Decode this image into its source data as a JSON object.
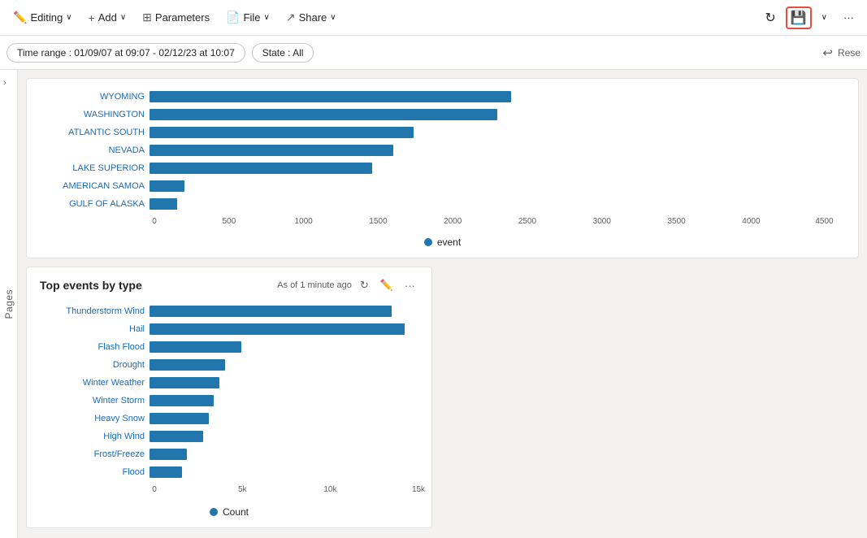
{
  "toolbar": {
    "editing_label": "Editing",
    "add_label": "Add",
    "parameters_label": "Parameters",
    "file_label": "File",
    "share_label": "Share",
    "refresh_icon": "↻",
    "save_icon": "💾",
    "more_icon": "···",
    "chevron_icon": "∨"
  },
  "filter_bar": {
    "time_range_label": "Time range : 01/09/07 at 09:07 - 02/12/23 at 10:07",
    "state_label": "State : All",
    "undo_icon": "↩",
    "reset_label": "Rese"
  },
  "pages_sidebar": {
    "label": "Pages",
    "chevron": "›"
  },
  "top_chart": {
    "rows": [
      {
        "label": "WYOMING",
        "pct": 52
      },
      {
        "label": "WASHINGTON",
        "pct": 50
      },
      {
        "label": "ATLANTIC SOUTH",
        "pct": 38
      },
      {
        "label": "NEVADA",
        "pct": 35
      },
      {
        "label": "LAKE SUPERIOR",
        "pct": 32
      },
      {
        "label": "AMERICAN SAMOA",
        "pct": 5
      },
      {
        "label": "GULF OF ALASKA",
        "pct": 4
      }
    ],
    "x_ticks": [
      {
        "label": "0",
        "pct": 0
      },
      {
        "label": "500",
        "pct": 10.8
      },
      {
        "label": "1000",
        "pct": 21.6
      },
      {
        "label": "1500",
        "pct": 32.4
      },
      {
        "label": "2000",
        "pct": 43.2
      },
      {
        "label": "2500",
        "pct": 54
      },
      {
        "label": "3000",
        "pct": 64.8
      },
      {
        "label": "3500",
        "pct": 75.6
      },
      {
        "label": "4000",
        "pct": 86.4
      },
      {
        "label": "4500",
        "pct": 97
      }
    ],
    "legend_label": "event",
    "legend_color": "#2176ae"
  },
  "bottom_chart": {
    "title": "Top events by type",
    "meta": "As of 1 minute ago",
    "rows": [
      {
        "label": "Thunderstorm Wind",
        "pct": 90
      },
      {
        "label": "Hail",
        "pct": 95
      },
      {
        "label": "Flash Flood",
        "pct": 34
      },
      {
        "label": "Drought",
        "pct": 28
      },
      {
        "label": "Winter Weather",
        "pct": 26
      },
      {
        "label": "Winter Storm",
        "pct": 24
      },
      {
        "label": "Heavy Snow",
        "pct": 22
      },
      {
        "label": "High Wind",
        "pct": 20
      },
      {
        "label": "Frost/Freeze",
        "pct": 14
      },
      {
        "label": "Flood",
        "pct": 12
      }
    ],
    "x_ticks": [
      {
        "label": "0",
        "pct": 0
      },
      {
        "label": "5k",
        "pct": 33.3
      },
      {
        "label": "10k",
        "pct": 66.6
      },
      {
        "label": "15k",
        "pct": 100
      }
    ],
    "legend_label": "Count",
    "legend_color": "#2176ae"
  }
}
